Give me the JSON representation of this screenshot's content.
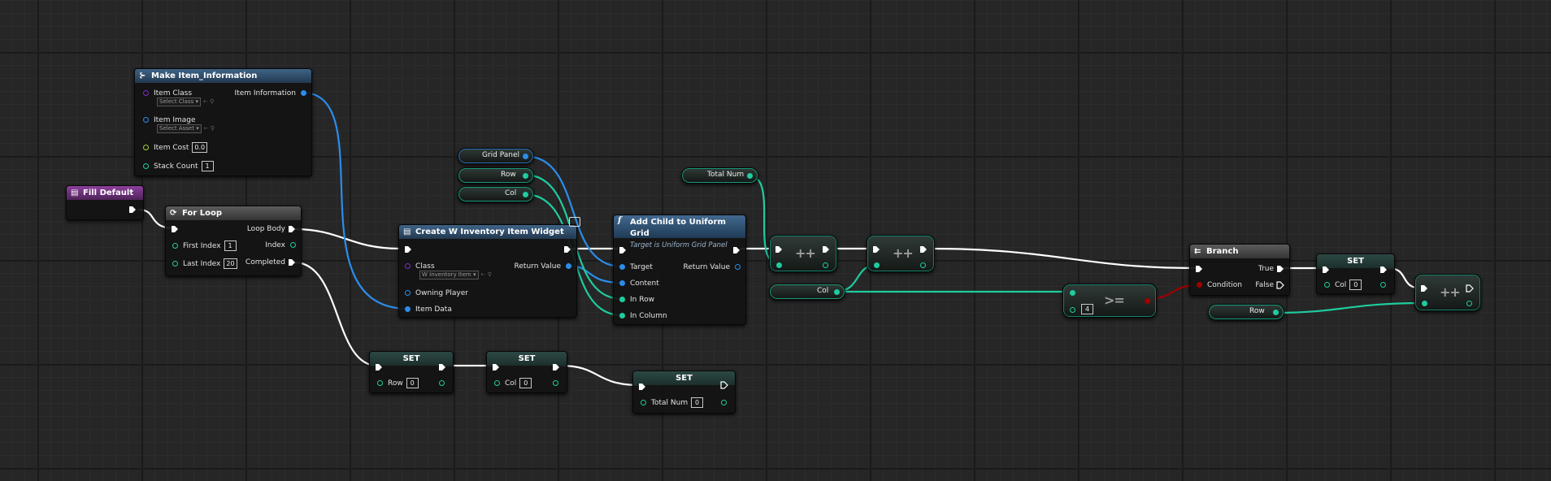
{
  "make_item": {
    "title": "Make Item_Information",
    "pins": {
      "item_class": "Item Class",
      "item_class_select": "Select Class",
      "item_image": "Item Image",
      "item_image_select": "Select Asset",
      "item_cost": "Item Cost",
      "item_cost_value": "0.0",
      "stack_count": "Stack Count",
      "stack_count_value": "1",
      "item_information": "Item Information"
    }
  },
  "fill_default": {
    "title": "Fill Default"
  },
  "for_loop": {
    "title": "For Loop",
    "pins": {
      "loop_body": "Loop Body",
      "first_index": "First Index",
      "first_index_value": "1",
      "index": "Index",
      "last_index": "Last Index",
      "last_index_value": "20",
      "completed": "Completed"
    }
  },
  "create_widget": {
    "title": "Create W Inventory Item Widget",
    "pins": {
      "class": "Class",
      "class_select": "W Inventory Item",
      "return_value": "Return Value",
      "owning_player": "Owning Player",
      "item_data": "Item Data"
    }
  },
  "vars": {
    "grid_panel": "Grid Panel",
    "row": "Row",
    "col": "Col",
    "total_num": "Total Num"
  },
  "add_child": {
    "title": "Add Child to Uniform Grid",
    "subtitle": "Target is Uniform Grid Panel",
    "pins": {
      "target": "Target",
      "return_value": "Return Value",
      "content": "Content",
      "in_row": "In Row",
      "in_column": "In Column"
    }
  },
  "ops": {
    "increment": "++",
    "gte": ">=",
    "gte_value": "4"
  },
  "branch": {
    "title": "Branch",
    "true": "True",
    "condition": "Condition",
    "false": "False"
  },
  "set_nodes": {
    "title": "SET",
    "row_label": "Row",
    "row_value": "0",
    "col_label": "Col",
    "col_value": "0",
    "total_label": "Total Num",
    "total_value": "0"
  },
  "colors": {
    "exec": "#ffffff",
    "integer": "#1fcc9f",
    "object": "#2b8dea",
    "class": "#7e2fc4",
    "float": "#9dd62c",
    "boolean": "#a00000",
    "function_header": "#2f5275",
    "event_header": "#7a3789"
  }
}
